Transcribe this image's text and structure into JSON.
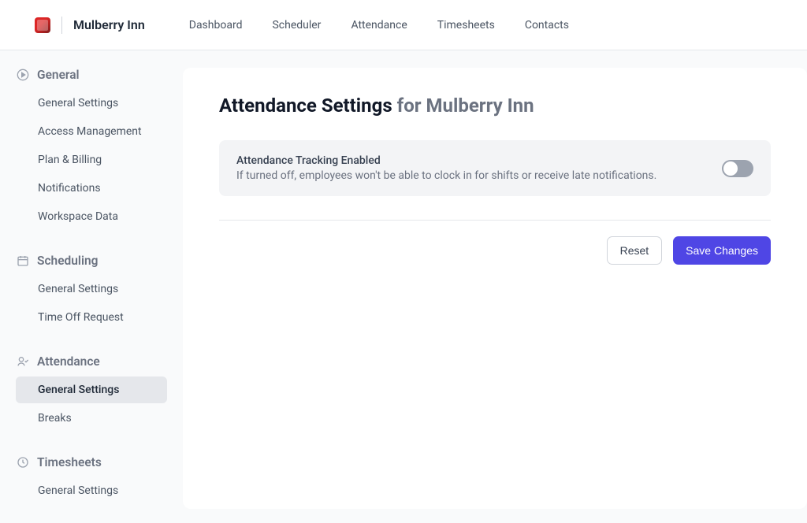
{
  "brand": {
    "name": "Mulberry Inn"
  },
  "topnav": {
    "dashboard": "Dashboard",
    "scheduler": "Scheduler",
    "attendance": "Attendance",
    "timesheets": "Timesheets",
    "contacts": "Contacts"
  },
  "sidebar": {
    "general": {
      "header": "General",
      "items": [
        "General Settings",
        "Access Management",
        "Plan & Billing",
        "Notifications",
        "Workspace Data"
      ]
    },
    "scheduling": {
      "header": "Scheduling",
      "items": [
        "General Settings",
        "Time Off Request"
      ]
    },
    "attendance": {
      "header": "Attendance",
      "items": [
        "General Settings",
        "Breaks"
      ]
    },
    "timesheets": {
      "header": "Timesheets",
      "items": [
        "General Settings"
      ]
    }
  },
  "page": {
    "title_prefix": "Attendance Settings",
    "title_suffix": "for Mulberry Inn"
  },
  "setting": {
    "label": "Attendance Tracking Enabled",
    "desc": "If turned off, employees won't be able to clock in for shifts or receive late notifications.",
    "enabled": false
  },
  "actions": {
    "reset": "Reset",
    "save": "Save Changes"
  }
}
